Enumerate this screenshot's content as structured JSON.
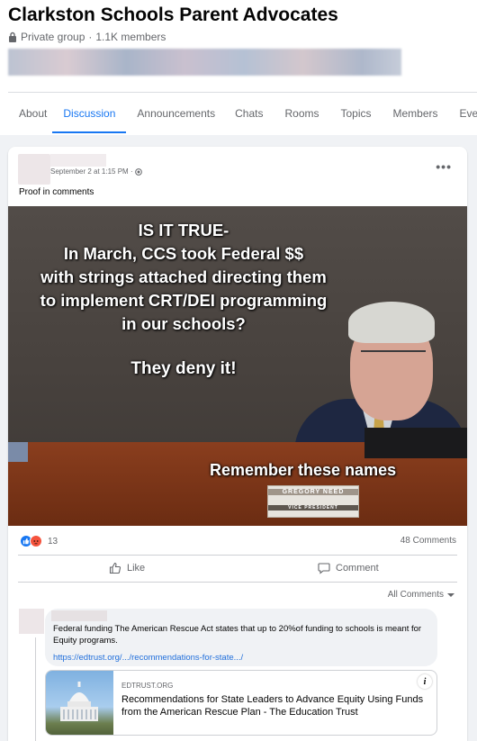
{
  "group": {
    "title": "Clarkston Schools Parent Advocates",
    "privacy": "Private group",
    "members": "1.1K members",
    "separator": "·"
  },
  "tabs": [
    {
      "label": "About"
    },
    {
      "label": "Discussion",
      "active": true
    },
    {
      "label": "Announcements"
    },
    {
      "label": "Chats"
    },
    {
      "label": "Rooms"
    },
    {
      "label": "Topics"
    },
    {
      "label": "Members"
    },
    {
      "label": "Events"
    }
  ],
  "post": {
    "time": "September 2 at 1:15 PM ·",
    "text": "Proof in comments",
    "image": {
      "lines": [
        "IS IT TRUE-",
        "In March, CCS took Federal $$",
        "with strings attached directing them",
        "to implement CRT/DEI programming",
        "in our schools?"
      ],
      "deny": "They deny it!",
      "remember": "Remember these names",
      "nameplate_name": "GREGORY NEED",
      "nameplate_title": "VICE PRESIDENT"
    },
    "reactions_count": "13",
    "comments_count": "48 Comments",
    "like_label": "Like",
    "comment_label": "Comment",
    "all_comments_label": "All Comments"
  },
  "comment": {
    "text": "Federal funding The American Rescue Act states that up to 20%of funding to schools is meant for Equity programs.",
    "link": "https://edtrust.org/.../recommendations-for-state.../",
    "preview": {
      "domain": "EDTRUST.ORG",
      "title": "Recommendations for State Leaders to Advance Equity Using Funds from the American Rescue Plan - The Education Trust"
    }
  },
  "colors": {
    "accent": "#1877f2",
    "link": "#216fdb",
    "muted": "#65676b",
    "angry": "#f5533d"
  },
  "icons": [
    "lock-icon",
    "globe-icon",
    "more-icon",
    "like-reaction-icon",
    "angry-reaction-icon",
    "thumbs-up-icon",
    "comment-icon",
    "chevron-down-icon",
    "info-icon"
  ]
}
